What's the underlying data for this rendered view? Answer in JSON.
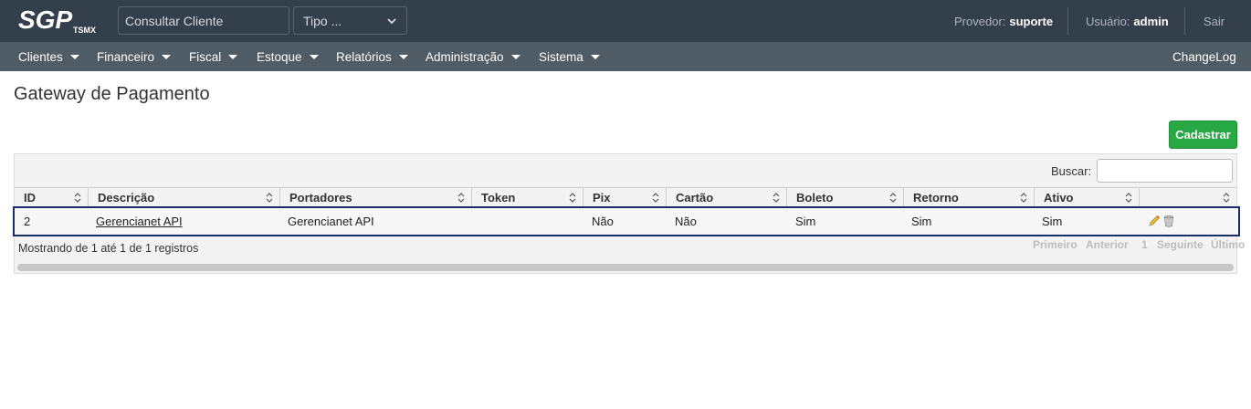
{
  "header": {
    "logo_text": "SGP",
    "logo_sub": "TSMX",
    "search": {
      "placeholder": "Consultar Cliente"
    },
    "tipo_select": {
      "selected": "Tipo ..."
    },
    "provedor_label": "Provedor:",
    "provedor_value": "suporte",
    "usuario_label": "Usuário:",
    "usuario_value": "admin",
    "logout_label": "Sair"
  },
  "nav": {
    "items": [
      {
        "label": "Clientes"
      },
      {
        "label": "Financeiro"
      },
      {
        "label": "Fiscal"
      },
      {
        "label": "Estoque"
      },
      {
        "label": "Relatórios"
      },
      {
        "label": "Administração"
      },
      {
        "label": "Sistema"
      }
    ],
    "changelog": "ChangeLog"
  },
  "page": {
    "title": "Gateway de Pagamento",
    "cadastrar_label": "Cadastrar"
  },
  "table": {
    "search_label": "Buscar:",
    "columns": [
      "ID",
      "Descrição",
      "Portadores",
      "Token",
      "Pix",
      "Cartão",
      "Boleto",
      "Retorno",
      "Ativo",
      ""
    ],
    "rows": [
      {
        "id": "2",
        "descricao": "Gerencianet API",
        "portadores": "Gerencianet API",
        "token": "",
        "pix": "Não",
        "cartao": "Não",
        "boleto": "Sim",
        "retorno": "Sim",
        "ativo": "Sim"
      }
    ],
    "info": "Mostrando de 1 até 1 de 1 registros",
    "pager": {
      "first": "Primeiro",
      "prev": "Anterior",
      "page": "1",
      "next": "Seguinte",
      "last": "Último"
    }
  },
  "icons": {
    "edit": "pencil-icon",
    "delete": "trash-icon",
    "sort": "sort-icon"
  },
  "colors": {
    "topbar": "#343f4c",
    "navbar": "#4f5b65",
    "primary_button": "#28a745",
    "row_highlight_border": "#1b2a6b"
  }
}
